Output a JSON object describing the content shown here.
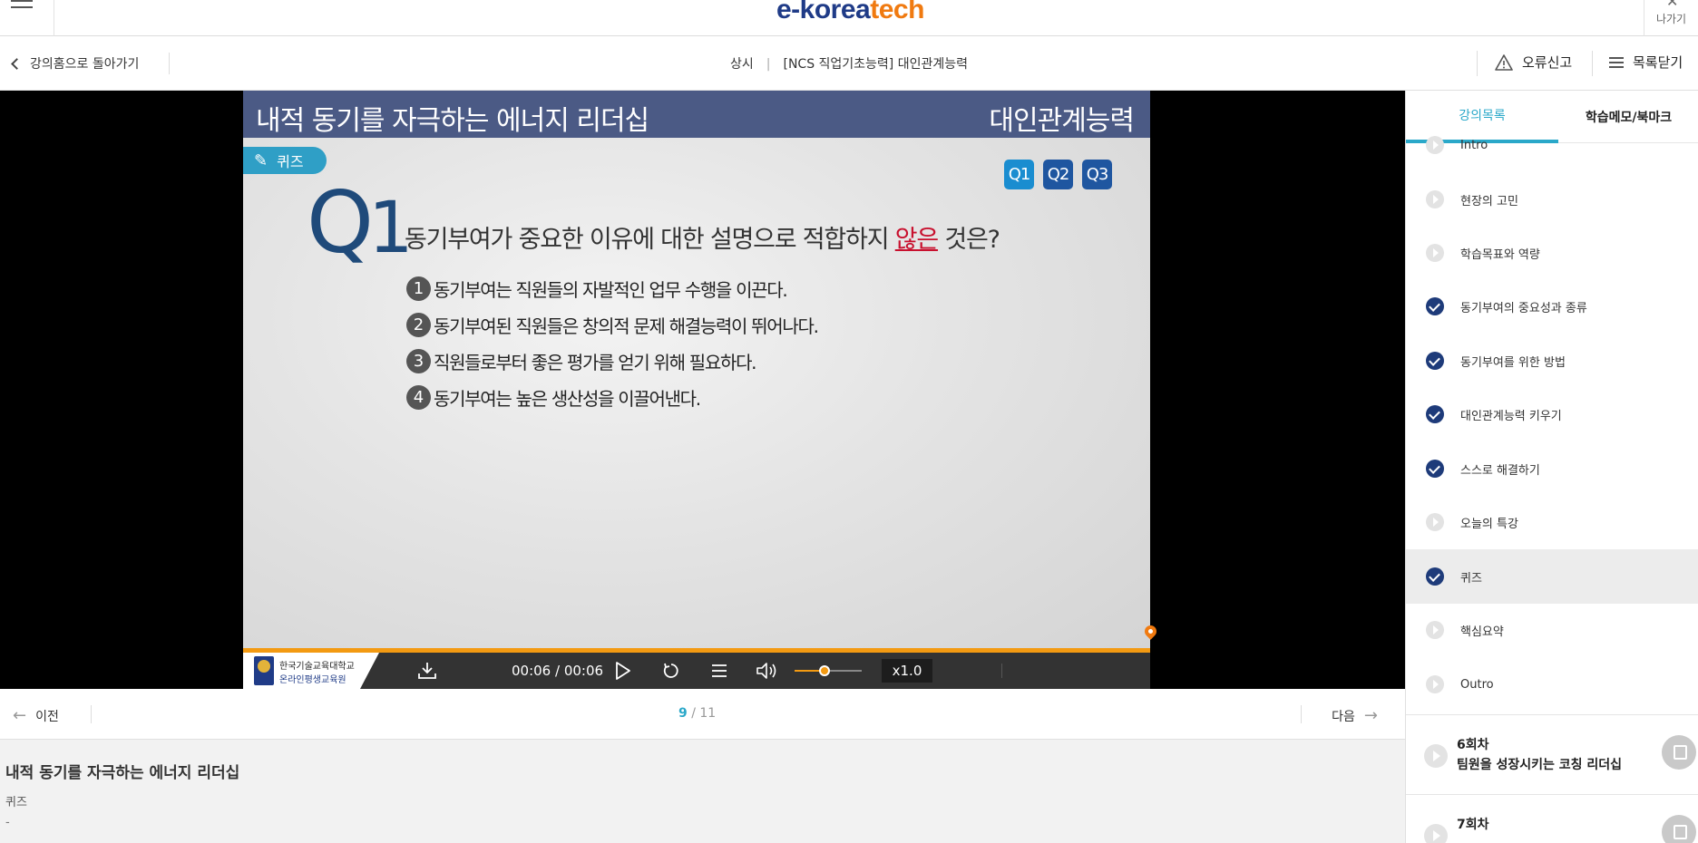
{
  "header": {
    "logo_main": "e-korea",
    "logo_accent": "tech",
    "exit_label": "나가기"
  },
  "subheader": {
    "back_label": "강의홈으로 돌아가기",
    "course_type": "상시",
    "course_separator": "|",
    "course_title": "[NCS 직업기초능력] 대인관계능력",
    "report_label": "오류신고",
    "close_list_label": "목록닫기"
  },
  "slide": {
    "title": "내적 동기를 자극하는 에너지 리더십",
    "category": "대인관계능력",
    "badge": "퀴즈",
    "question_tabs": [
      "Q1",
      "Q2",
      "Q3"
    ],
    "big_q": "Q",
    "big_q_num": "1",
    "question_pre": "동기부여가 중요한 이유에 대한 설명으로 적합하지 ",
    "question_emph": "않은",
    "question_post": " 것은?",
    "options": [
      {
        "num": "1",
        "text": "동기부여는 직원들의 자발적인 업무 수행을 이끈다."
      },
      {
        "num": "2",
        "text": "동기부여된 직원들은 창의적 문제 해결능력이 뛰어나다."
      },
      {
        "num": "3",
        "text": "직원들로부터 좋은 평가를 얻기 위해 필요하다."
      },
      {
        "num": "4",
        "text": "동기부여는 높은 생산성을 이끌어낸다."
      }
    ]
  },
  "controls": {
    "brand_line1": "한국기술교육대학교",
    "brand_line2": "온라인평생교육원",
    "time": "00:06 / 00:06",
    "speed": "x1.0",
    "volume": 0.45
  },
  "pager": {
    "prev_label": "이전",
    "next_label": "다음",
    "current": "9",
    "separator": " / ",
    "total": "11"
  },
  "info": {
    "title": "내적 동기를 자극하는 에너지 리더십",
    "subtitle": "퀴즈",
    "note": "-"
  },
  "panel": {
    "tab_list": "강의목록",
    "tab_memo": "학습메모/북마크",
    "items": [
      {
        "label": "Intro",
        "status": "play"
      },
      {
        "label": "현장의 고민",
        "status": "play"
      },
      {
        "label": "학습목표와 역량",
        "status": "play"
      },
      {
        "label": "동기부여의 중요성과 종류",
        "status": "done"
      },
      {
        "label": "동기부여를 위한 방법",
        "status": "done"
      },
      {
        "label": "대인관계능력 키우기",
        "status": "done"
      },
      {
        "label": "스스로 해결하기",
        "status": "done"
      },
      {
        "label": "오늘의 특강",
        "status": "play"
      },
      {
        "label": "퀴즈",
        "status": "done"
      },
      {
        "label": "핵심요약",
        "status": "play"
      },
      {
        "label": "Outro",
        "status": "play"
      }
    ],
    "sessions": [
      {
        "no": "6회차",
        "name": "팀원을 성장시키는 코칭 리더십"
      },
      {
        "no": "7회차",
        "name": ""
      }
    ]
  }
}
